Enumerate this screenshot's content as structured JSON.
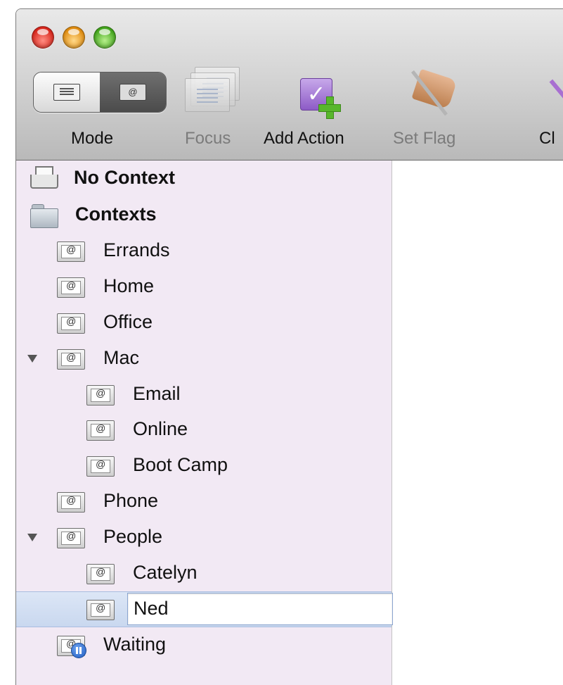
{
  "toolbar": {
    "mode_label": "Mode",
    "focus_label": "Focus",
    "add_action_label": "Add Action",
    "set_flag_label": "Set Flag",
    "clean_up_label": "Cl"
  },
  "sidebar": {
    "no_context": "No Context",
    "contexts_header": "Contexts",
    "items": [
      {
        "label": "Errands"
      },
      {
        "label": "Home"
      },
      {
        "label": "Office"
      },
      {
        "label": "Mac"
      },
      {
        "label": "Email"
      },
      {
        "label": "Online"
      },
      {
        "label": "Boot Camp"
      },
      {
        "label": "Phone"
      },
      {
        "label": "People"
      },
      {
        "label": "Catelyn"
      },
      {
        "label": "Ned"
      },
      {
        "label": "Waiting"
      }
    ]
  },
  "colors": {
    "sidebar_bg": "#f2e9f4",
    "selection": "#c9d8ef",
    "add_action_accent": "#8d5bc6"
  },
  "icons": {
    "context": "context-at-icon",
    "inbox": "inbox-tray-icon",
    "folder": "folder-icon",
    "waiting": "pause-badge-icon"
  }
}
